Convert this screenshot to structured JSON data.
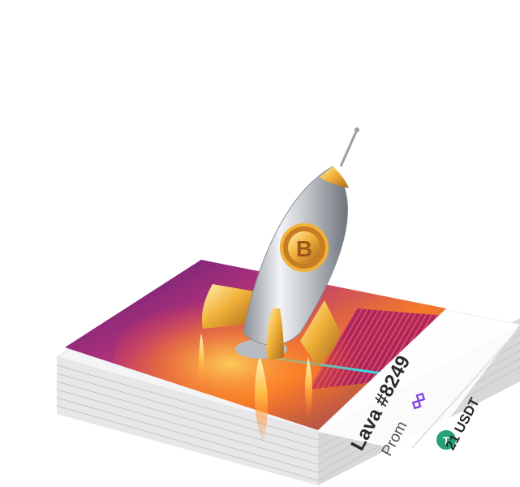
{
  "card": {
    "title": "Lava #8249",
    "brand": "Prom",
    "price": "21 USDT"
  },
  "colors": {
    "accent_gold": "#e6a52a",
    "silver": "#cfd3d8",
    "usdt_green": "#26a17b",
    "poly_purple": "#8247e5"
  },
  "icons": [
    "bitcoin-icon",
    "polygon-icon",
    "usdt-icon",
    "rocket-illustration"
  ]
}
